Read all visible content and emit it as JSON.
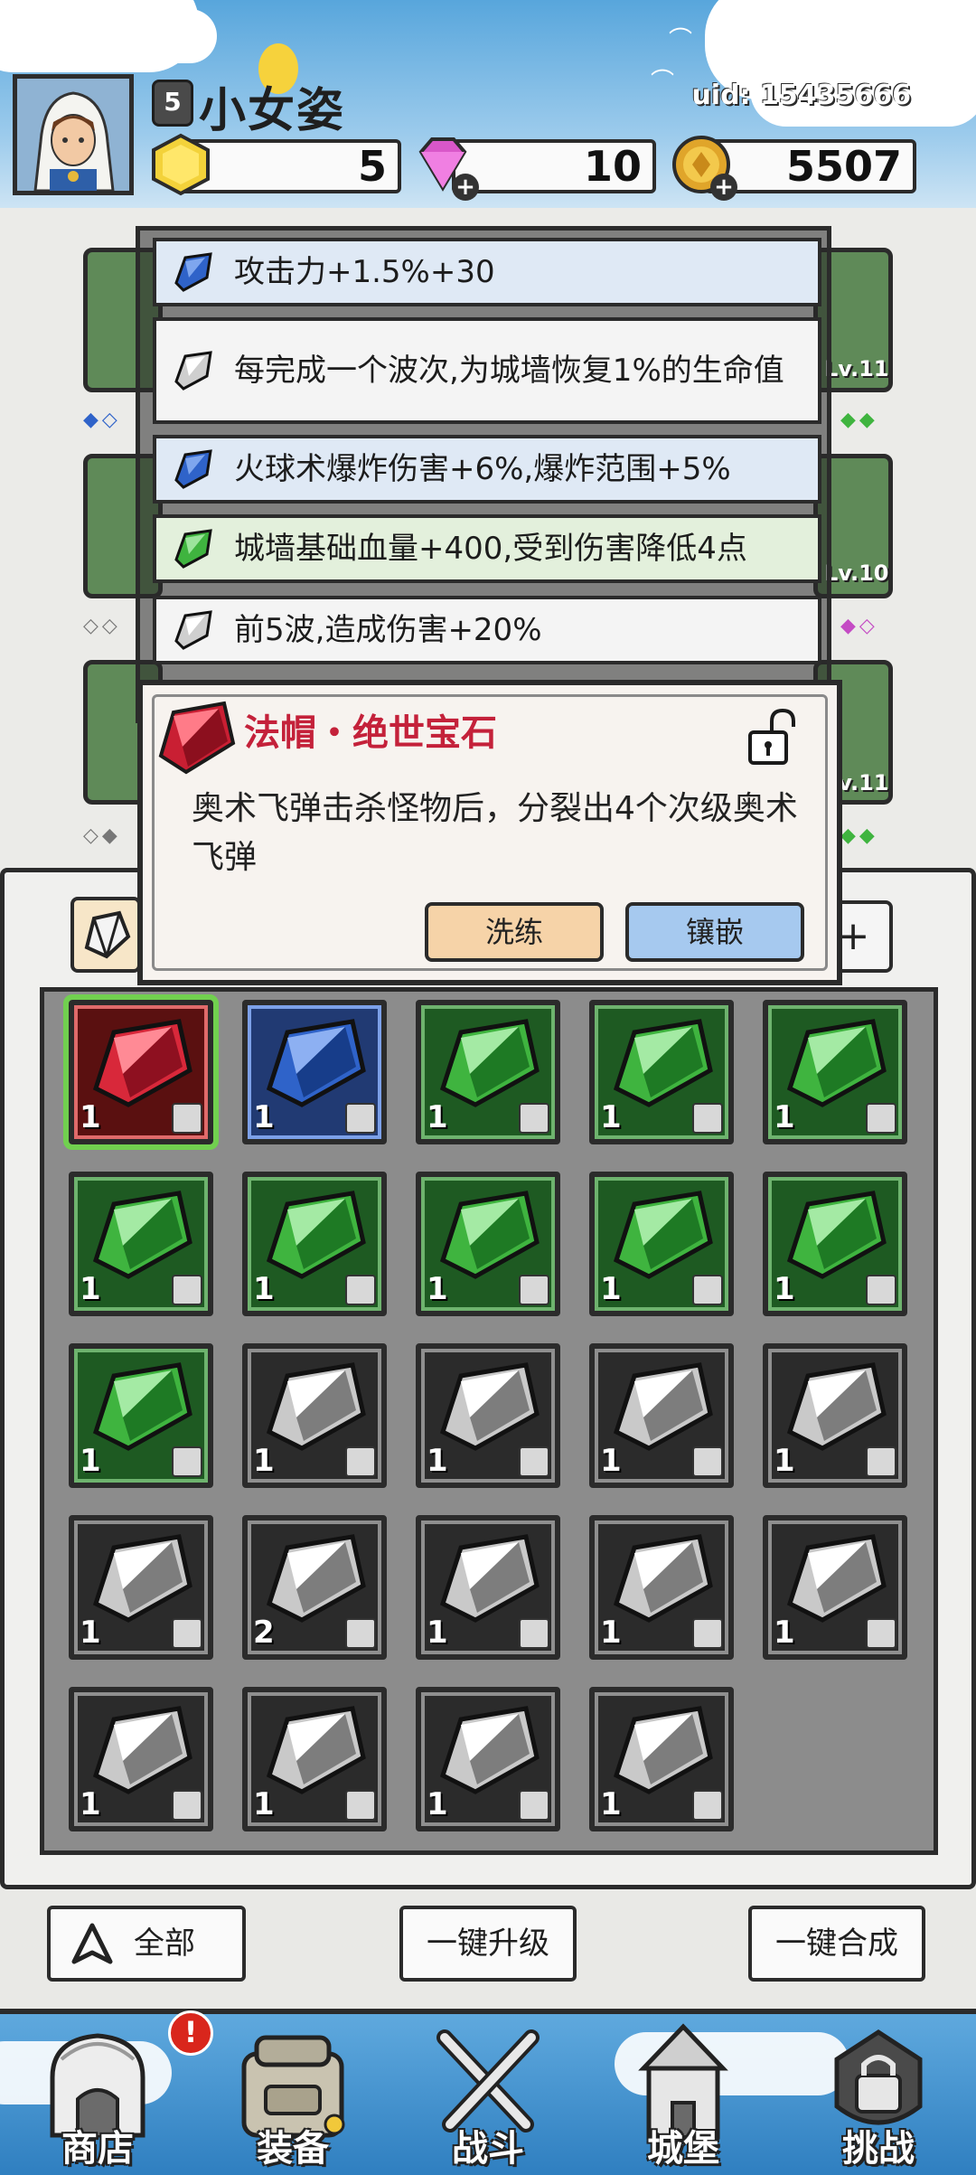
{
  "header": {
    "player_name": "小女姿",
    "player_level": "5",
    "uid": "uid: 15435666",
    "resources": [
      {
        "name": "gold-gem",
        "value": "5"
      },
      {
        "name": "diamond",
        "value": "10"
      },
      {
        "name": "coin",
        "value": "5507"
      }
    ]
  },
  "equipment_slots": {
    "levels": [
      "Lv.11",
      "Lv.10",
      "Lv.11"
    ]
  },
  "effects": [
    {
      "gem": "blue",
      "text": "攻击力+1.5%+30"
    },
    {
      "gem": "white",
      "text": "每完成一个波次,为城墙恢复1%的生命值"
    },
    {
      "gem": "blue",
      "text": "火球术爆炸伤害+6%,爆炸范围+5%"
    },
    {
      "gem": "green",
      "text": "城墙基础血量+400,受到伤害降低4点"
    },
    {
      "gem": "white",
      "text": "前5波,造成伤害+20%"
    }
  ],
  "popup": {
    "title": "法帽・绝世宝石",
    "description": "奥术飞弹击杀怪物后，分裂出4个次级奥术飞弹",
    "refine_label": "洗练",
    "inlay_label": "镶嵌"
  },
  "inventory": {
    "plus_label": "+",
    "items": [
      {
        "color": "red",
        "count": "1",
        "slot": "ring",
        "selected": true
      },
      {
        "color": "blue",
        "count": "1",
        "slot": "armor"
      },
      {
        "color": "green",
        "count": "1",
        "slot": "ring"
      },
      {
        "color": "green",
        "count": "1",
        "slot": "ring"
      },
      {
        "color": "green",
        "count": "1",
        "slot": "ring"
      },
      {
        "color": "green",
        "count": "1",
        "slot": "ring"
      },
      {
        "color": "green",
        "count": "1",
        "slot": "armor"
      },
      {
        "color": "green",
        "count": "1",
        "slot": "armor"
      },
      {
        "color": "green",
        "count": "1",
        "slot": "armor"
      },
      {
        "color": "green",
        "count": "1",
        "slot": "staff"
      },
      {
        "color": "green",
        "count": "1",
        "slot": "staff"
      },
      {
        "color": "white",
        "count": "1",
        "slot": "ring"
      },
      {
        "color": "white",
        "count": "1",
        "slot": "ring"
      },
      {
        "color": "white",
        "count": "1",
        "slot": "armor"
      },
      {
        "color": "white",
        "count": "1",
        "slot": "armor"
      },
      {
        "color": "white",
        "count": "1",
        "slot": "boots"
      },
      {
        "color": "white",
        "count": "2",
        "slot": "boots"
      },
      {
        "color": "white",
        "count": "1",
        "slot": "staff"
      },
      {
        "color": "white",
        "count": "1",
        "slot": "hat"
      },
      {
        "color": "white",
        "count": "1",
        "slot": "hat"
      },
      {
        "color": "white",
        "count": "1",
        "slot": "hat"
      },
      {
        "color": "white",
        "count": "1",
        "slot": "hat"
      },
      {
        "color": "white",
        "count": "1",
        "slot": "amulet"
      },
      {
        "color": "white",
        "count": "1",
        "slot": "amulet"
      }
    ]
  },
  "actions": {
    "filter_label": "全部",
    "upgrade_all_label": "一键升级",
    "merge_all_label": "一键合成"
  },
  "nav": {
    "alert": "!",
    "items": [
      {
        "label": "商店",
        "icon": "shop-icon"
      },
      {
        "label": "装备",
        "icon": "equipment-bag-icon"
      },
      {
        "label": "战斗",
        "icon": "crossed-swords-icon"
      },
      {
        "label": "城堡",
        "icon": "castle-icon"
      },
      {
        "label": "挑战",
        "icon": "challenge-lock-icon"
      }
    ]
  },
  "colors": {
    "gem_red": "#d8283a",
    "gem_blue": "#2f63c9",
    "gem_green": "#3fb43f",
    "gem_white": "#d8d8d8",
    "title_red": "#c4213a"
  }
}
